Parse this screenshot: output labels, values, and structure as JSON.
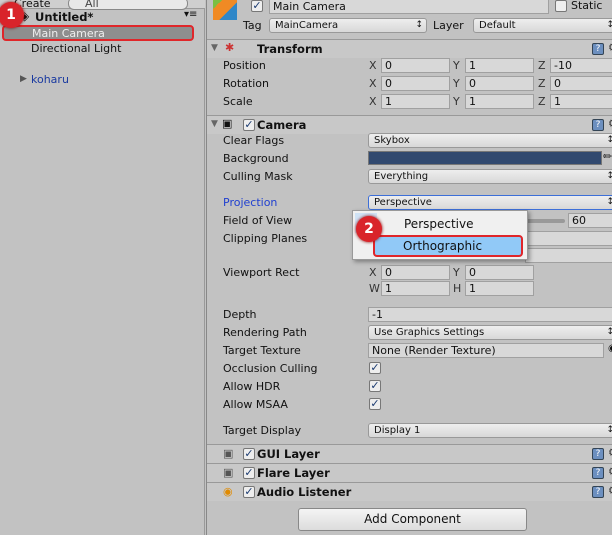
{
  "hierarchy": {
    "create_label": "Create",
    "search_placeholder": "All",
    "scene": "Untitled*",
    "items": [
      "Main Camera",
      "Directional Light"
    ],
    "koharu": "koharu",
    "step_badge": "1"
  },
  "inspector": {
    "object_name": "Main Camera",
    "static_label": "Static",
    "tag_label": "Tag",
    "tag_value": "MainCamera",
    "layer_label": "Layer",
    "layer_value": "Default",
    "transform": {
      "title": "Transform",
      "rows": [
        {
          "label": "Position",
          "x": "0",
          "y": "1",
          "z": "-10"
        },
        {
          "label": "Rotation",
          "x": "0",
          "y": "0",
          "z": "0"
        },
        {
          "label": "Scale",
          "x": "1",
          "y": "1",
          "z": "1"
        }
      ]
    },
    "camera": {
      "title": "Camera",
      "clear_flags_label": "Clear Flags",
      "clear_flags": "Skybox",
      "background_label": "Background",
      "background_color": "#31496f",
      "culling_mask_label": "Culling Mask",
      "culling_mask": "Everything",
      "projection_label": "Projection",
      "projection": "Perspective",
      "fov_label": "Field of View",
      "fov": "60",
      "clipping_label": "Clipping Planes",
      "viewport_label": "Viewport Rect",
      "viewport": {
        "x": "0",
        "y": "0",
        "w": "1",
        "h": "1"
      },
      "depth_label": "Depth",
      "depth": "-1",
      "rendering_path_label": "Rendering Path",
      "rendering_path": "Use Graphics Settings",
      "target_texture_label": "Target Texture",
      "target_texture": "None (Render Texture)",
      "occlusion_label": "Occlusion Culling",
      "hdr_label": "Allow HDR",
      "msaa_label": "Allow MSAA",
      "target_display_label": "Target Display",
      "target_display": "Display 1"
    },
    "projection_menu": {
      "options": [
        "Perspective",
        "Orthographic"
      ],
      "step_badge": "2"
    },
    "components": [
      "GUI Layer",
      "Flare Layer",
      "Audio Listener"
    ],
    "add_component": "Add Component",
    "axes": {
      "x": "X",
      "y": "Y",
      "z": "Z",
      "w": "W",
      "h": "H"
    }
  }
}
